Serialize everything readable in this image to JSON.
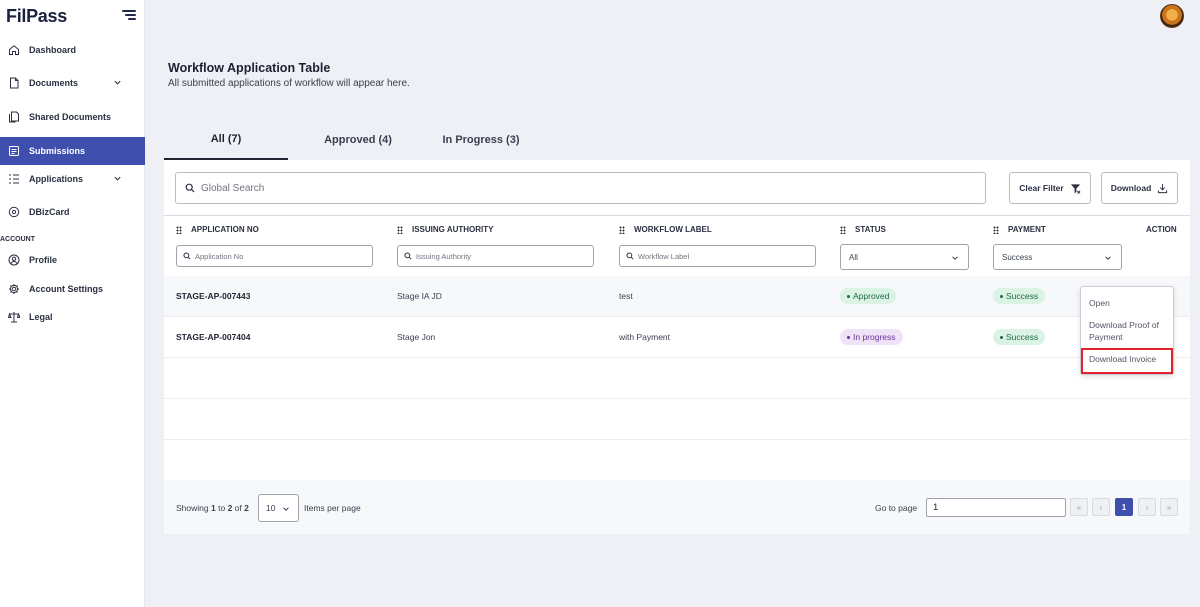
{
  "app": {
    "logo": "FilPass"
  },
  "sidebar": {
    "items": [
      {
        "label": "Dashboard",
        "icon": "home-icon"
      },
      {
        "label": "Documents",
        "icon": "document-icon"
      },
      {
        "label": "Shared Documents",
        "icon": "shared-documents-icon"
      },
      {
        "label": "Submissions",
        "icon": "submissions-icon"
      },
      {
        "label": "Applications",
        "icon": "applications-icon"
      },
      {
        "label": "DBizCard",
        "icon": "card-icon"
      }
    ],
    "account_label": "ACCOUNT",
    "account_items": [
      {
        "label": "Profile",
        "icon": "profile-icon"
      },
      {
        "label": "Account Settings",
        "icon": "gear-icon"
      },
      {
        "label": "Legal",
        "icon": "scale-icon"
      }
    ]
  },
  "page": {
    "title": "Workflow Application Table",
    "subtitle": "All submitted applications of workflow will appear here."
  },
  "tabs": [
    {
      "label": "All (7)"
    },
    {
      "label": "Approved (4)"
    },
    {
      "label": "In Progress (3)"
    }
  ],
  "toolbar": {
    "search_placeholder": "Global Search",
    "clear_filter": "Clear Filter",
    "download": "Download"
  },
  "table": {
    "columns": [
      "APPLICATION NO",
      "ISSUING AUTHORITY",
      "WORKFLOW LABEL",
      "STATUS",
      "PAYMENT",
      "ACTION"
    ],
    "filters": {
      "application_no": "Application No",
      "issuing_authority": "Issuing Authority",
      "workflow_label": "Workflow Label",
      "status": "All",
      "payment": "Success"
    },
    "rows": [
      {
        "application_no": "STAGE-AP-007443",
        "issuing_authority": "Stage IA JD",
        "workflow_label": "test",
        "status": "Approved",
        "payment": "Success"
      },
      {
        "application_no": "STAGE-AP-007404",
        "issuing_authority": "Stage Jon",
        "workflow_label": "with Payment",
        "status": "In progress",
        "payment": "Success"
      }
    ]
  },
  "action_menu": {
    "open": "Open",
    "download_proof_line1": "Download Proof of",
    "download_proof_line2": "Payment",
    "download_invoice": "Download Invoice"
  },
  "footer": {
    "showing_prefix": "Showing",
    "from": "1",
    "to_word": "to",
    "to": "2",
    "of_word": "of",
    "total": "2",
    "per_page": "10",
    "items_per_page": "Items per page",
    "go_to_page": "Go to page",
    "page_input": "1",
    "current_page": "1"
  },
  "colors": {
    "accent": "#3f4fae",
    "approved": "#daf3e5",
    "in_progress": "#efe3f8",
    "highlight": "#e0242b"
  }
}
